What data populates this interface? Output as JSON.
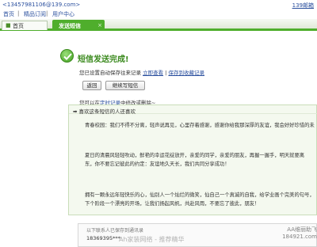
{
  "topbar": {
    "email": "<13457981106@139.com>",
    "inbox": "139邮箱"
  },
  "links": {
    "home": "首页",
    "sep": "|",
    "apps": "精品订阅",
    "settings": "用户中心"
  },
  "tabs": [
    {
      "label": "首页"
    },
    {
      "label": "发送短信"
    }
  ],
  "result": {
    "title": "短信发送完成!",
    "saved_text": "您已设置自动保存往来记录",
    "view_link": "立即查看",
    "sep": "|",
    "fav_link": "保存到收藏记录"
  },
  "buttons": {
    "back": "返回",
    "continue": "继续写短信"
  },
  "select_line": {
    "prefix": "您可以在",
    "link": "定时记录",
    "suffix": "中修改或删除~"
  },
  "panel": {
    "header": "➡ 喜欢这条短信的人还喜欢",
    "p1": "青春校园：我们不得不分离，轻声说再见，心里存着感谢，感谢你给我那深厚的友谊，我会好好珍惜的未来，想你们时。",
    "p2_l1": "夏日的清晨风轻轻吹动，鲜艳的幸运花绽放开，亲爱的同学，亲爱的朋友，再握一握手，明天就要离",
    "p2_l2": "东，你不要忘记彼此的约定：友谊地久天长，我们共同分享成功！",
    "p3_l1": "拥有一颗永远年轻快乐的心，仙别人一个灿烂的微笑，仙自己一个真诚的自我，给学业画个完美的句号，",
    "p3_l2": "下个阶段一个漂亮的开场，让我们扬起风帆，共赴风雨，不要忘了彼此，朋友！"
  },
  "contacts": {
    "header": "以下联系人已保存到通讯录",
    "number": "18369395***"
  },
  "watermark": "Ah家装网络 - 推荐精华",
  "wm_right": "AA维丽助飞\n184921.com"
}
